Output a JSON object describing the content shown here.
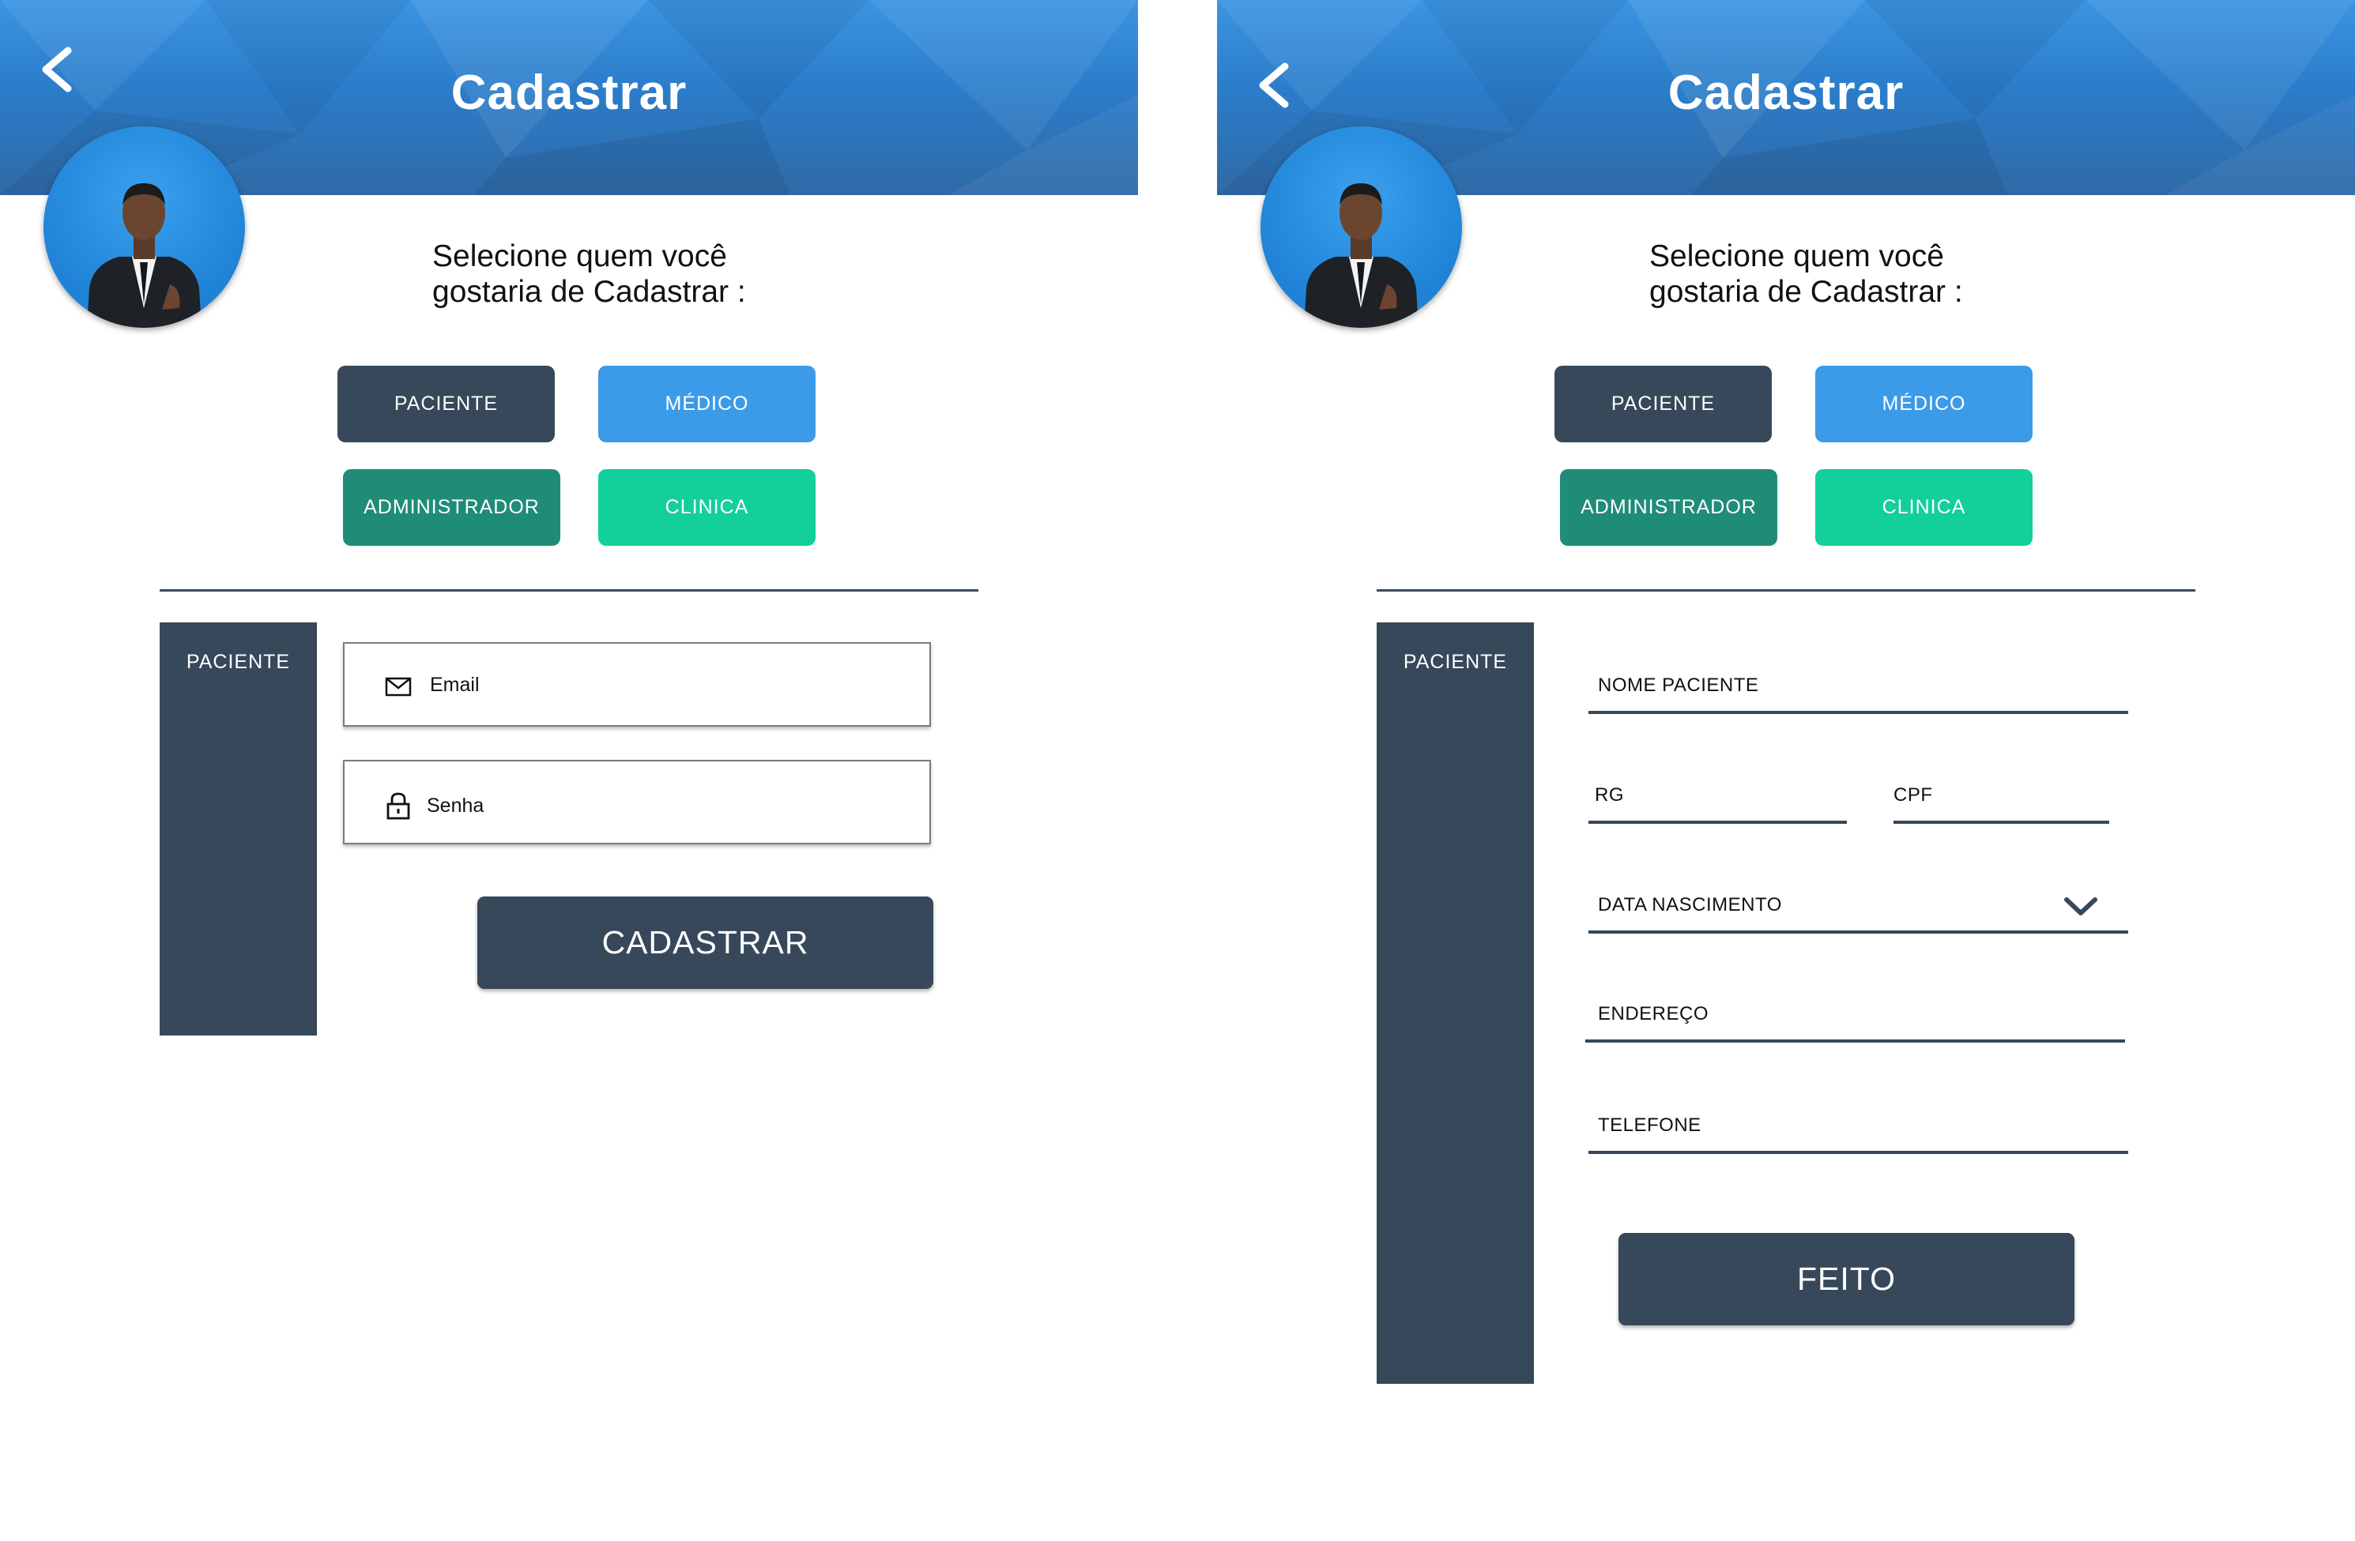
{
  "screens": [
    {
      "header": {
        "title": "Cadastrar"
      },
      "prompt": {
        "line1": "Selecione quem você",
        "line2": "gostaria de Cadastrar :"
      },
      "roles": {
        "paciente": "PACIENTE",
        "medico": "MÉDICO",
        "administrador": "ADMINISTRADOR",
        "clinica": "CLINICA"
      },
      "panel_label": "PACIENTE",
      "form": {
        "email_placeholder": "Email",
        "senha_placeholder": "Senha",
        "submit_label": "CADASTRAR"
      }
    },
    {
      "header": {
        "title": "Cadastrar"
      },
      "prompt": {
        "line1": "Selecione quem você",
        "line2": "gostaria de Cadastrar :"
      },
      "roles": {
        "paciente": "PACIENTE",
        "medico": "MÉDICO",
        "administrador": "ADMINISTRADOR",
        "clinica": "CLINICA"
      },
      "panel_label": "PACIENTE",
      "form": {
        "nome_label": "NOME PACIENTE",
        "rg_label": "RG",
        "cpf_label": "CPF",
        "nascimento_label": "DATA NASCIMENTO",
        "endereco_label": "ENDEREÇO",
        "telefone_label": "TELEFONE",
        "submit_label": "FEITO"
      }
    }
  ],
  "icons": {
    "back": "chevron-left-icon",
    "email": "envelope-icon",
    "senha": "lock-icon",
    "dropdown": "chevron-down-icon"
  },
  "colors": {
    "header_blue": "#2f86d6",
    "dark_slate": "#364859",
    "medico_blue": "#3b9be8",
    "admin_teal": "#1f8c78",
    "clinica_green": "#12cf9c"
  }
}
